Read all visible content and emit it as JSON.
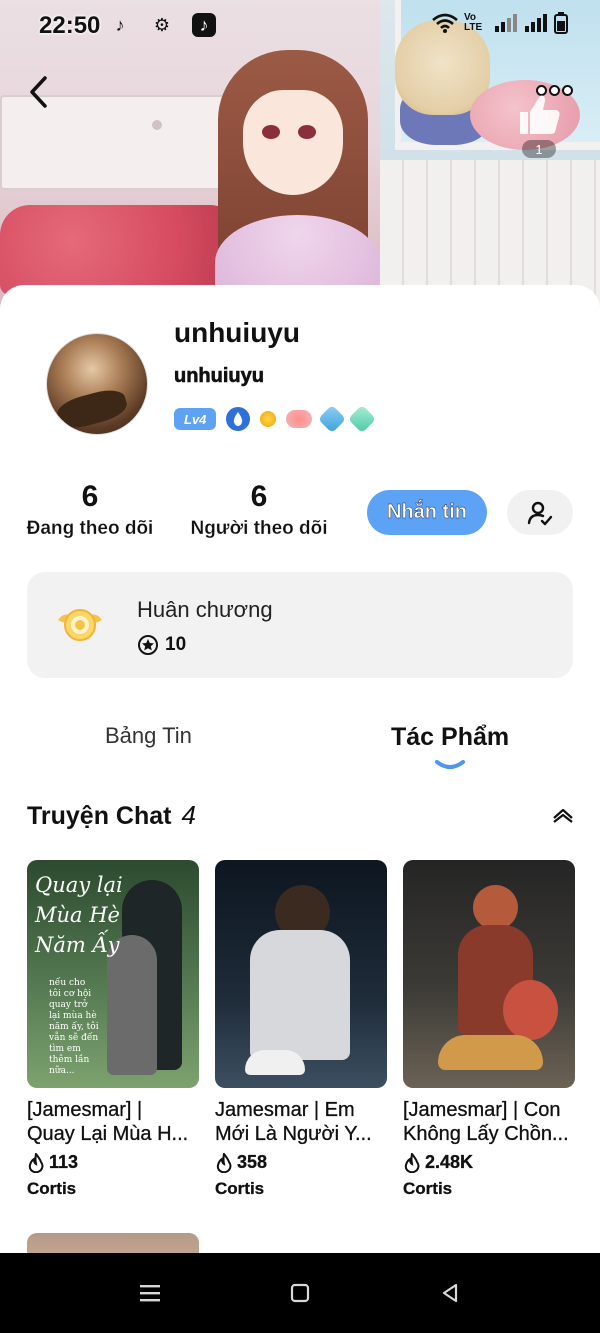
{
  "status_bar": {
    "time": "22:50",
    "network_label": "Vo LTE"
  },
  "header": {
    "like_count": "1"
  },
  "profile": {
    "display_name": "unhuiuyu",
    "username": "unhuiuyu",
    "level": "Lv4"
  },
  "stats": {
    "following_count": "6",
    "following_label": "Đang theo dõi",
    "followers_count": "6",
    "followers_label": "Người theo dõi"
  },
  "actions": {
    "message_label": "Nhắn tin"
  },
  "medal": {
    "title": "Huân chương",
    "value": "10"
  },
  "tabs": [
    {
      "label": "Bảng Tin",
      "active": false
    },
    {
      "label": "Tác Phẩm",
      "active": true
    }
  ],
  "section": {
    "title": "Truyện Chat",
    "count": "4"
  },
  "works": [
    {
      "cover_text": "Quay lại Mùa Hè Năm Ấy",
      "cover_note": "nếu cho tôi cơ hội quay trở lại mùa hè năm ấy, tôi vẫn sẽ đến tìm em thêm lần nữa...",
      "title_line1": "[Jamesmar] |",
      "title_line2": "Quay Lại Mùa H...",
      "views": "113",
      "author": "Cortis"
    },
    {
      "title_line1": "Jamesmar | Em",
      "title_line2": "Mới Là Người Y...",
      "views": "358",
      "author": "Cortis"
    },
    {
      "title_line1": "[Jamesmar] | Con",
      "title_line2": "Không Lấy Chồn...",
      "views": "2.48K",
      "author": "Cortis"
    }
  ],
  "colors": {
    "accent_blue": "#5ca2f5",
    "card_background": "#f2f2f2",
    "nav_background": "#000000"
  }
}
